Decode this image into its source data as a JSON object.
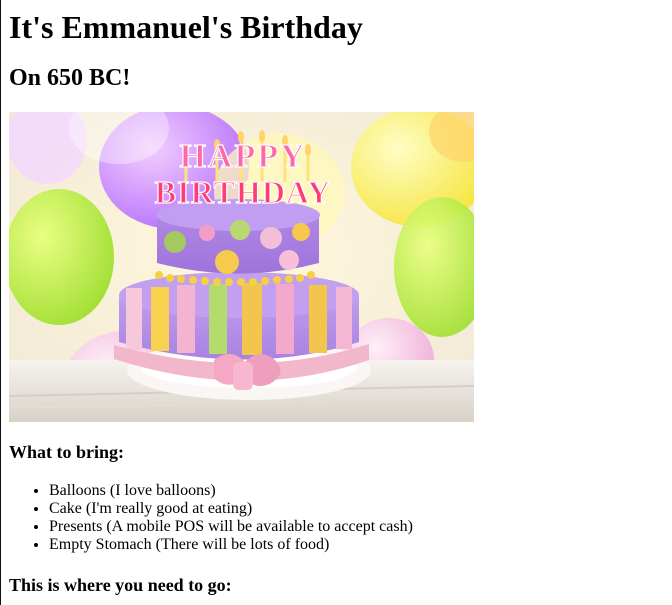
{
  "page": {
    "title": "It's Emmanuel's Birthday",
    "subtitle": "On 650 BC!",
    "image": {
      "alt": "Birthday cake",
      "topper_text": "HAPPY BIRTHDAY",
      "colors": {
        "cake_purple": "#a77ee0",
        "cake_pink": "#f7b6d1",
        "cake_yellow": "#f4ce4f",
        "cake_green": "#b7d96b"
      }
    },
    "bring_heading": "What to bring:",
    "bring_items": [
      "Balloons (I love balloons)",
      "Cake (I'm really good at eating)",
      "Presents (A mobile POS will be available to accept cash)",
      "Empty Stomach (There will be lots of food)"
    ],
    "go_heading": "This is where you need to go:"
  }
}
